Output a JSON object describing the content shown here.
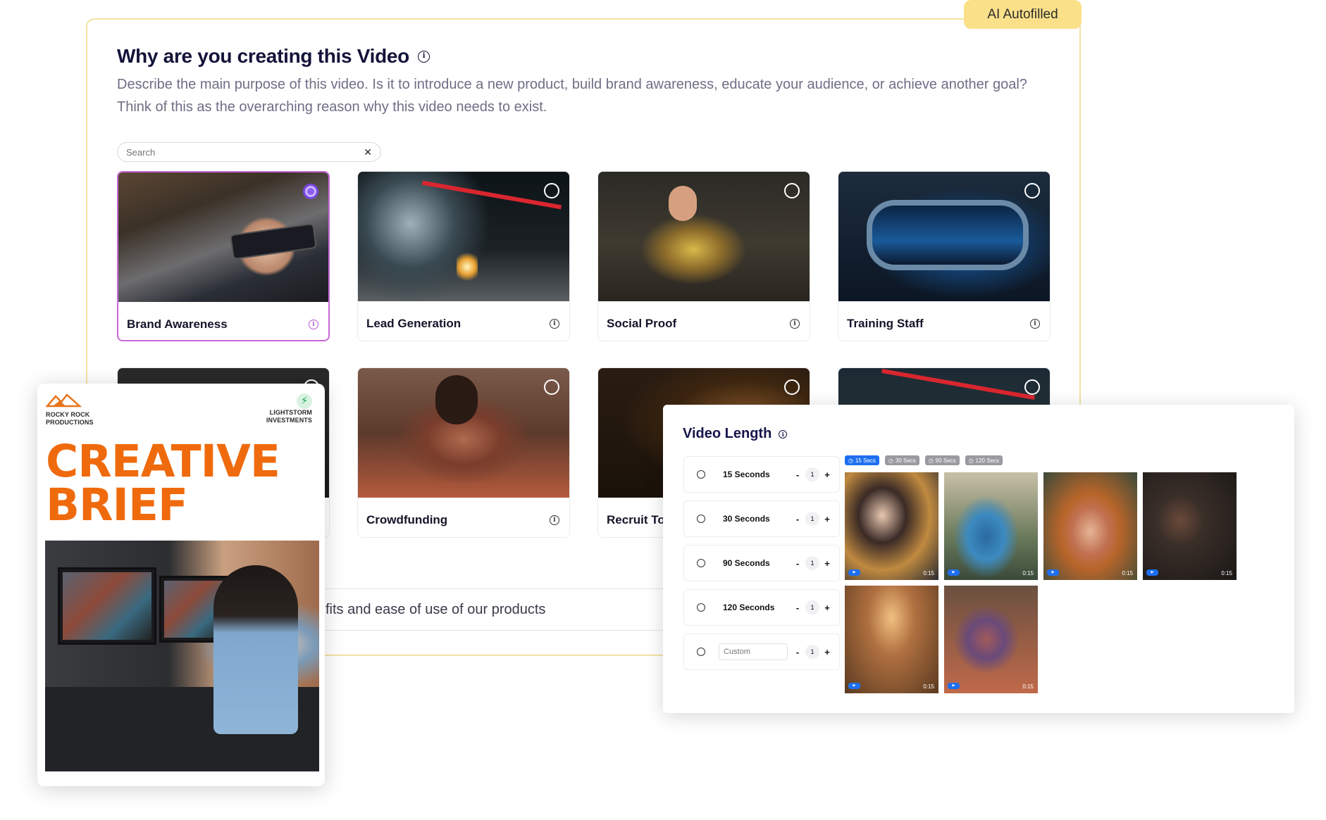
{
  "badge": "AI Autofilled",
  "purpose": {
    "title": "Why are you creating this Video",
    "description": "Describe the main purpose of this video. Is it to introduce a new product, build brand awareness, educate your audience, or achieve another goal? Think of this as the overarching reason why this video needs to exist.",
    "search_placeholder": "Search",
    "options": [
      {
        "label": "Brand Awareness",
        "selected": true
      },
      {
        "label": "Lead Generation",
        "selected": false
      },
      {
        "label": "Social Proof",
        "selected": false
      },
      {
        "label": "Training Staff",
        "selected": false
      },
      {
        "label": "Crowdfunding",
        "selected": false
      },
      {
        "label": "Recruit To",
        "selected": false
      }
    ],
    "tagline": "fits and ease of use of our products"
  },
  "brief": {
    "logo_left": "ROCKY ROCK\nPRODUCTIONS",
    "logo_left_1": "ROCKY ROCK",
    "logo_left_2": "PRODUCTIONS",
    "logo_right_1": "LIGHTSTORM",
    "logo_right_2": "INVESTMENTS",
    "title_1": "CREATIVE",
    "title_2": "BRIEF"
  },
  "video_length": {
    "title": "Video Length",
    "options": [
      {
        "label": "15 Seconds",
        "count": "1"
      },
      {
        "label": "30 Seconds",
        "count": "1"
      },
      {
        "label": "90 Seconds",
        "count": "1"
      },
      {
        "label": "120 Seconds",
        "count": "1"
      }
    ],
    "custom_placeholder": "Custom",
    "custom_count": "1",
    "chips": [
      "15 Secs",
      "30 Secs",
      "90 Secs",
      "120 Secs"
    ],
    "active_chip": "15 Secs",
    "thumbnails": [
      {
        "duration": "0:15"
      },
      {
        "duration": "0:15"
      },
      {
        "duration": "0:15"
      },
      {
        "duration": "0:15"
      },
      {
        "duration": "0:15"
      },
      {
        "duration": "0:15"
      }
    ]
  },
  "colors": {
    "accent_purple": "#c66ad8",
    "badge_yellow": "#fbe08a",
    "brief_orange": "#ef6a0c",
    "chip_blue": "#1e6ff0"
  }
}
